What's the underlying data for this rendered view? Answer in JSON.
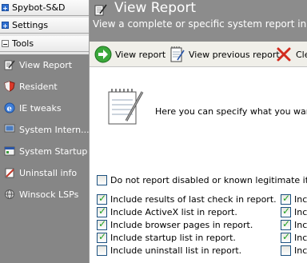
{
  "sidebar": {
    "sections": [
      {
        "label": "Spybot-S&D",
        "expanded": false
      },
      {
        "label": "Settings",
        "expanded": false
      },
      {
        "label": "Tools",
        "expanded": true
      }
    ],
    "tools": [
      {
        "label": "View Report",
        "icon": "document-pencil-icon"
      },
      {
        "label": "Resident",
        "icon": "shield-icon"
      },
      {
        "label": "IE tweaks",
        "icon": "ie-globe-icon"
      },
      {
        "label": "System Intern...",
        "icon": "monitor-icon"
      },
      {
        "label": "System Startup",
        "icon": "startup-icon"
      },
      {
        "label": "Uninstall info",
        "icon": "uninstall-icon"
      },
      {
        "label": "Winsock LSPs",
        "icon": "network-icon"
      }
    ]
  },
  "header": {
    "title": "View Report",
    "subtitle": "View a complete or specific system report in th"
  },
  "toolbar": {
    "view_report": "View report",
    "view_previous": "View previous report",
    "clear": "Cle"
  },
  "content": {
    "intro": "Here you can specify what you want in th",
    "options": [
      {
        "label": "Do not report disabled or known legitimate items.",
        "checked": false
      },
      {
        "label": "Include results of last check in report.",
        "checked": true
      },
      {
        "label": "Include ActiveX list in report.",
        "checked": true
      },
      {
        "label": "Include browser pages in report.",
        "checked": true
      },
      {
        "label": "Include startup list in report.",
        "checked": true
      },
      {
        "label": "Include uninstall list in report.",
        "checked": false
      }
    ],
    "right_options": [
      {
        "label": "Incl",
        "checked": true
      },
      {
        "label": "Incl",
        "checked": true
      },
      {
        "label": "Incl",
        "checked": true
      },
      {
        "label": "Incl",
        "checked": true
      },
      {
        "label": "Incl",
        "checked": false
      }
    ]
  },
  "colors": {
    "sidebar_tools_bg": "#868686",
    "title_bar_bg": "#8c8c8c",
    "toolbar_bg": "#f0efe9",
    "checkbox_border": "#1c5180",
    "check_mark": "#21a121"
  }
}
